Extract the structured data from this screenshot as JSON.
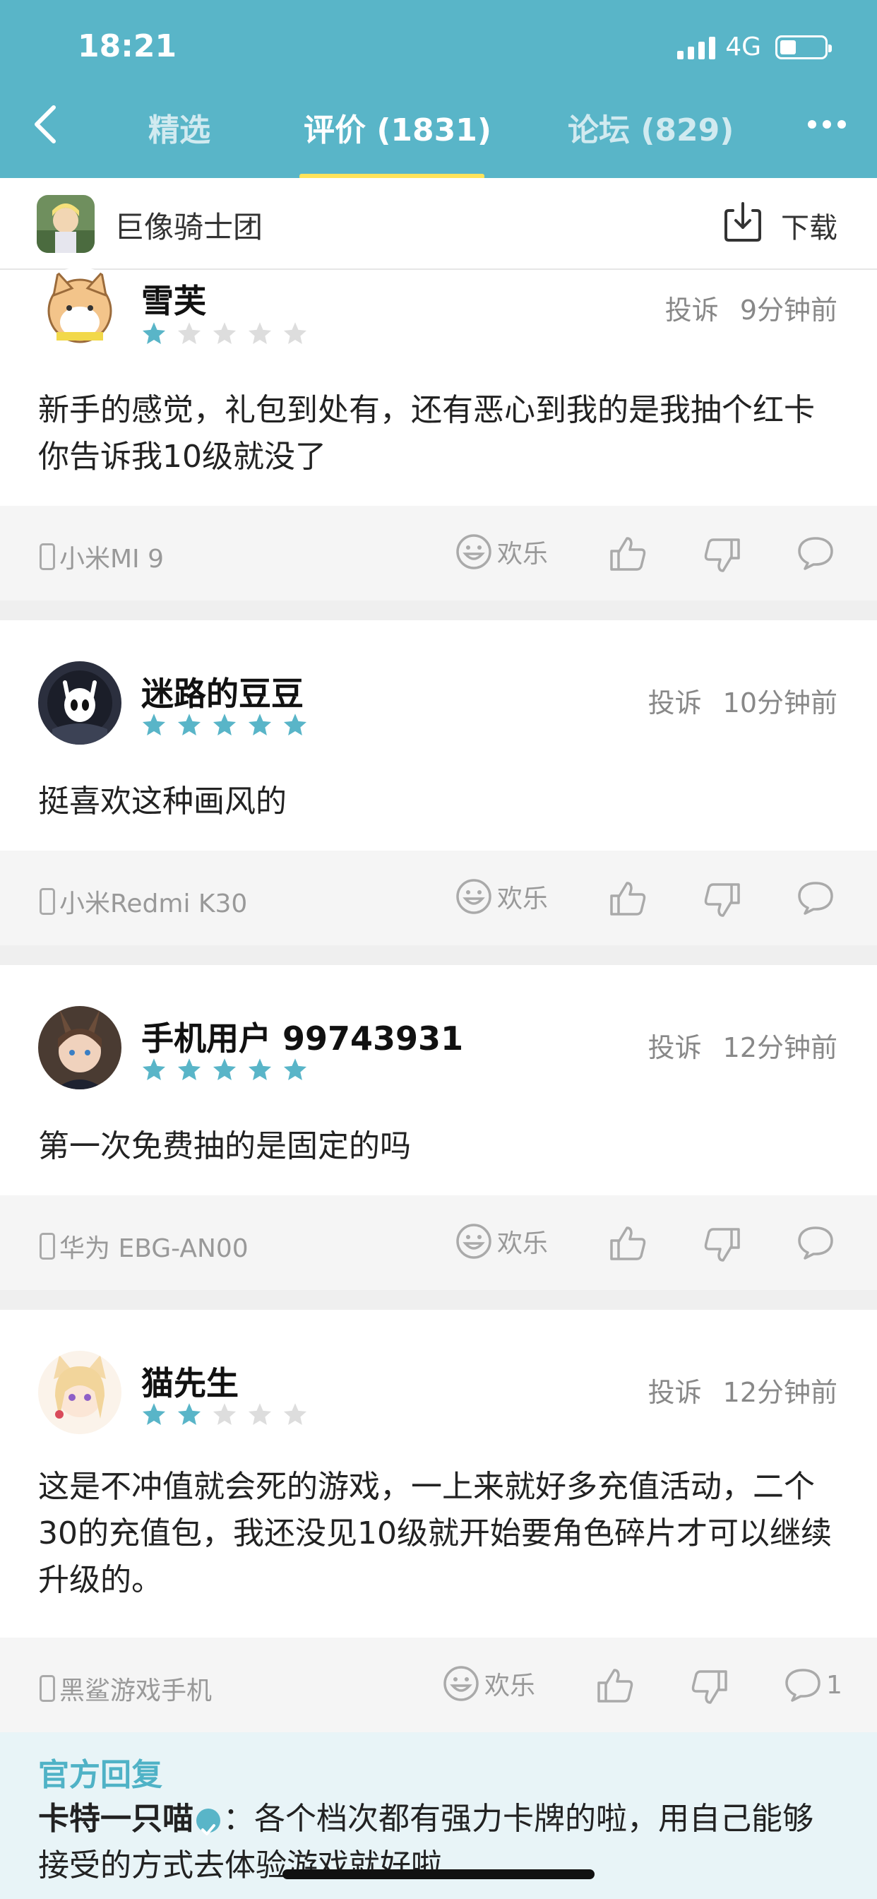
{
  "status": {
    "time": "18:21",
    "network": "4G"
  },
  "nav": {
    "tabs": [
      {
        "label": "精选"
      },
      {
        "label": "评价 (1831)"
      },
      {
        "label": "论坛 (829)"
      }
    ]
  },
  "game": {
    "name": "巨像骑士团",
    "download_label": "下载"
  },
  "reviews": [
    {
      "user": "雪芙",
      "rating": 1,
      "report": "投诉",
      "time": "9分钟前",
      "content": "新手的感觉，礼包到处有，还有恶心到我的是我抽个红卡你告诉我10级就没了",
      "device": "小米MI 9",
      "emotion": "欢乐",
      "comments": ""
    },
    {
      "user": "迷路的豆豆",
      "rating": 5,
      "report": "投诉",
      "time": "10分钟前",
      "content": "挺喜欢这种画风的",
      "device": "小米Redmi K30",
      "emotion": "欢乐",
      "comments": ""
    },
    {
      "user": "手机用户 99743931",
      "rating": 5,
      "report": "投诉",
      "time": "12分钟前",
      "content": "第一次免费抽的是固定的吗",
      "device": "华为 EBG-AN00",
      "emotion": "欢乐",
      "comments": ""
    },
    {
      "user": "猫先生",
      "rating": 2,
      "report": "投诉",
      "time": "12分钟前",
      "content": "这是不冲值就会死的游戏，一上来就好多充值活动，二个30的充值包，我还没见10级就开始要角色碎片才可以继续升级的。",
      "device": "黑鲨游戏手机",
      "emotion": "欢乐",
      "comments": "1"
    }
  ],
  "official_reply": {
    "title": "官方回复",
    "author": "卡特一只喵",
    "text": "：各个档次都有强力卡牌的啦，用自己能够接受的方式去体验游戏就好啦"
  },
  "colors": {
    "brand": "#59b5c8",
    "star_on": "#59b5c8",
    "star_off": "#dddddd",
    "tab_indicator": "#ffe35a"
  }
}
